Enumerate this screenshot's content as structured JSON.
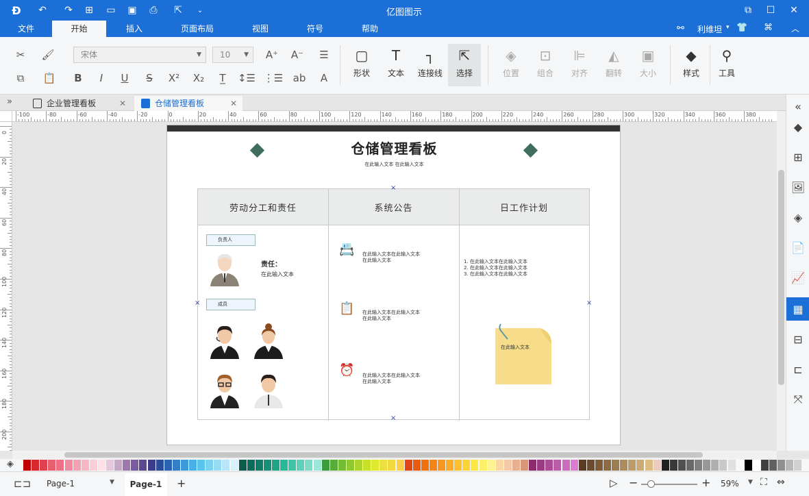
{
  "app": {
    "title": "亿图图示"
  },
  "menu": {
    "items": [
      "文件",
      "开始",
      "插入",
      "页面布局",
      "视图",
      "符号",
      "帮助"
    ],
    "active": "开始"
  },
  "user": {
    "name": "利维坦"
  },
  "ribbon": {
    "font_name": "宋体",
    "font_size": "10",
    "big_buttons": [
      "形状",
      "文本",
      "连接线",
      "选择",
      "位置",
      "组合",
      "对齐",
      "翻转",
      "大小",
      "样式",
      "工具"
    ]
  },
  "tabs": [
    {
      "label": "企业管理看板"
    },
    {
      "label": "仓储管理看板"
    }
  ],
  "ruler": {
    "h": [
      "-100",
      "-80",
      "-60",
      "-40",
      "-20",
      "0",
      "20",
      "40",
      "60",
      "80",
      "100",
      "120",
      "140",
      "160",
      "180",
      "200",
      "220",
      "240",
      "260",
      "280",
      "300",
      "320",
      "340",
      "360",
      "380"
    ],
    "v": [
      "0",
      "20",
      "40",
      "60",
      "80",
      "100",
      "120",
      "140",
      "160",
      "180",
      "200"
    ]
  },
  "board": {
    "title": "仓储管理看板",
    "subtitle": "在此输入文本 在此输入文本",
    "columns": [
      "劳动分工和责任",
      "系统公告",
      "日工作计划"
    ],
    "leader_tag": "负责人",
    "duty_label": "责任：",
    "duty_text": "在此输入文本",
    "member_tag": "成员",
    "notices": [
      {
        "line1": "在此输入文本在此输入文本",
        "line2": "在此输入文本"
      },
      {
        "line1": "在此输入文本在此输入文本",
        "line2": "在此输入文本"
      },
      {
        "line1": "在此输入文本在此输入文本",
        "line2": "在此输入文本"
      }
    ],
    "plan": [
      "1.  在此输入文本在此输入文本",
      "2.  在此输入文本在此输入文本",
      "3.  在此输入文本在此输入文本"
    ],
    "sticky_text": "在此输入文本"
  },
  "status": {
    "page_dropdown": "Page-1",
    "page_tab": "Page-1",
    "zoom": "59%"
  },
  "colors": {
    "accent": "#1b6fd6",
    "diamond": "#3f6e5e",
    "header_bg": "#e9ecea"
  }
}
